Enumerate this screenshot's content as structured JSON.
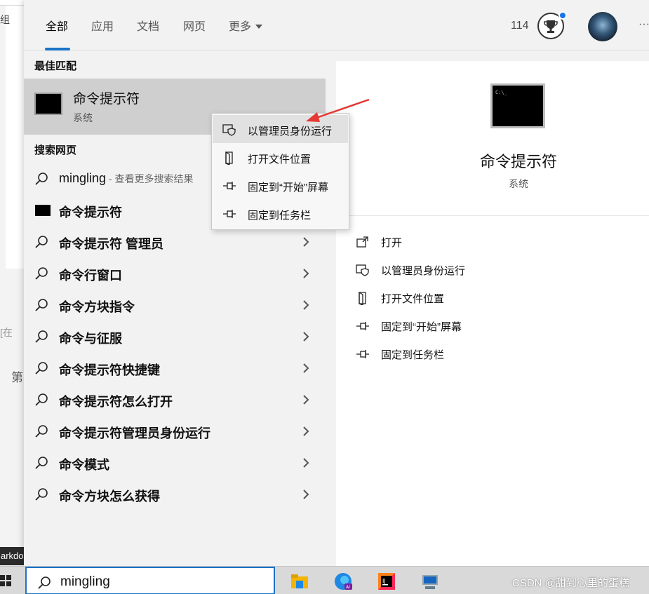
{
  "background": {
    "side_text_1": "组",
    "side_text_2": "[在",
    "side_text_3": "第",
    "dark_label": "arkdo"
  },
  "tabs": [
    {
      "label": "全部"
    },
    {
      "label": "应用"
    },
    {
      "label": "文档"
    },
    {
      "label": "网页"
    },
    {
      "label": "更多"
    }
  ],
  "header": {
    "points": "114"
  },
  "best_match": {
    "section_title": "最佳匹配",
    "title": "命令提示符",
    "subtitle": "系统"
  },
  "web_search": {
    "section_title": "搜索网页",
    "first": {
      "query": "mingling",
      "hint": " - 查看更多搜索结果"
    },
    "items": [
      {
        "label": "命令提示符"
      },
      {
        "label": "命令提示符 管理员"
      },
      {
        "label": "命令行窗口"
      },
      {
        "label": "命令方块指令"
      },
      {
        "label": "命令与征服"
      },
      {
        "label": "命令提示符快捷键"
      },
      {
        "label": "命令提示符怎么打开"
      },
      {
        "label": "命令提示符管理员身份运行"
      },
      {
        "label": "命令模式"
      },
      {
        "label": "命令方块怎么获得"
      }
    ]
  },
  "context_menu": {
    "items": [
      {
        "label": "以管理员身份运行",
        "icon": "shield-window-icon"
      },
      {
        "label": "打开文件位置",
        "icon": "file-location-icon"
      },
      {
        "label": "固定到“开始”屏幕",
        "icon": "pin-icon"
      },
      {
        "label": "固定到任务栏",
        "icon": "pin-icon"
      }
    ]
  },
  "preview": {
    "title": "命令提示符",
    "subtitle": "系统",
    "actions": [
      {
        "label": "打开",
        "icon": "open-icon"
      },
      {
        "label": "以管理员身份运行",
        "icon": "shield-window-icon"
      },
      {
        "label": "打开文件位置",
        "icon": "file-location-icon"
      },
      {
        "label": "固定到“开始”屏幕",
        "icon": "pin-icon"
      },
      {
        "label": "固定到任务栏",
        "icon": "pin-icon"
      }
    ]
  },
  "taskbar": {
    "search_value": "mingling",
    "watermark": "CSDN @甜到心里的蛋糕"
  },
  "colors": {
    "accent": "#1a73c7",
    "highlight": "#cfcfcf",
    "arrow": "#e53935"
  }
}
